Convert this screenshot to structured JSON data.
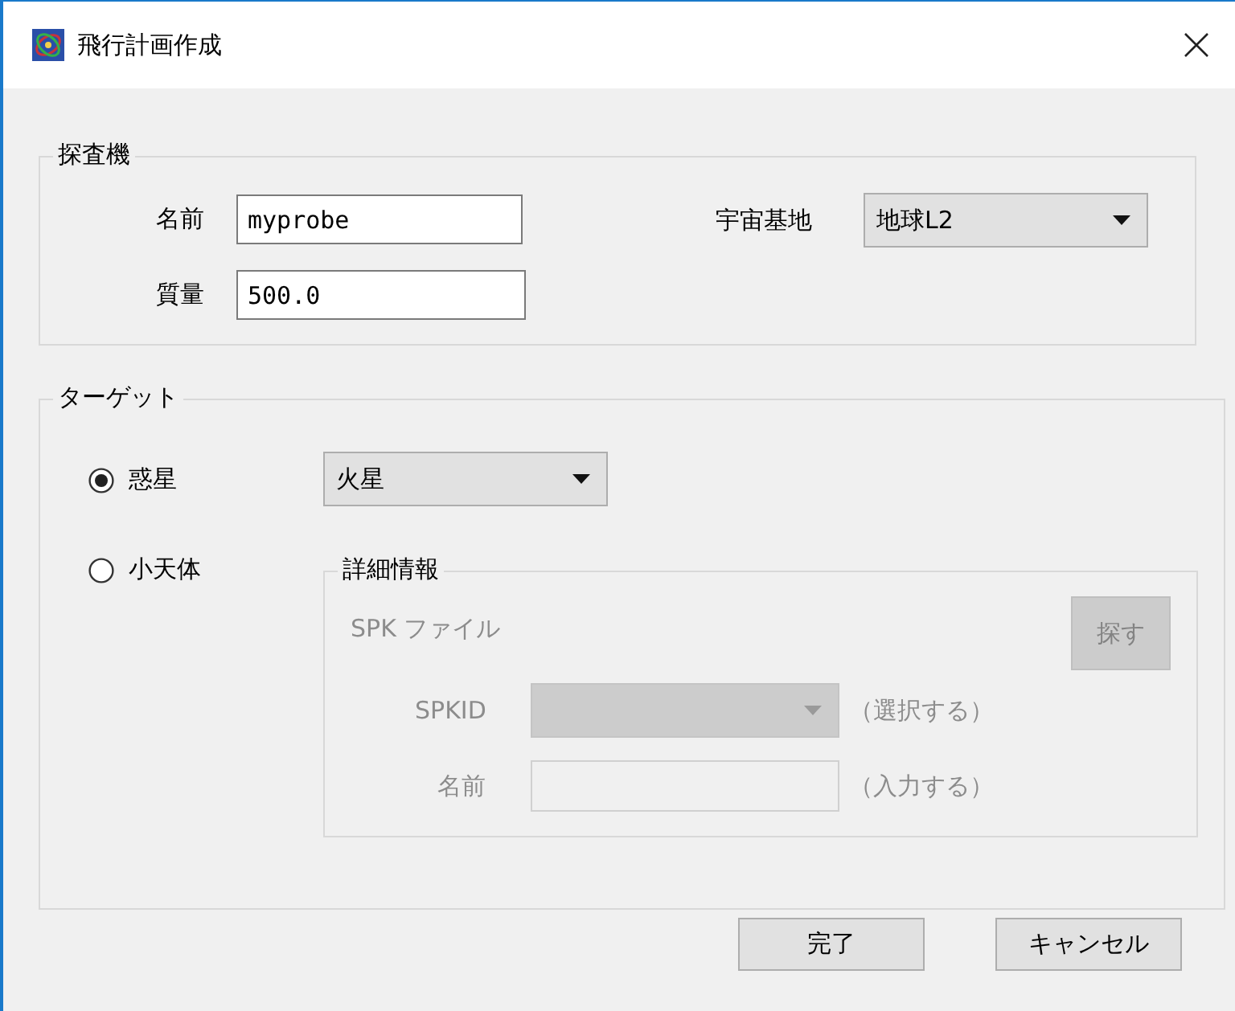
{
  "window": {
    "title": "飛行計画作成"
  },
  "probe": {
    "legend": "探査機",
    "name": {
      "label": "名前",
      "value": "myprobe"
    },
    "mass": {
      "label": "質量",
      "value": "500.0"
    },
    "base": {
      "label": "宇宙基地",
      "value": "地球L2"
    }
  },
  "target": {
    "legend": "ターゲット",
    "options": [
      {
        "label": "惑星",
        "selected": true
      },
      {
        "label": "小天体",
        "selected": false
      }
    ],
    "planet": {
      "value": "火星"
    },
    "details": {
      "legend": "詳細情報",
      "disabled": true,
      "spk_file": {
        "label": "SPK ファイル",
        "button": "探す"
      },
      "spkid": {
        "label": "SPKID",
        "hint": "（選択する）"
      },
      "name": {
        "label": "名前",
        "hint": "（入力する）"
      }
    }
  },
  "buttons": [
    "完了",
    "キャンセル"
  ]
}
